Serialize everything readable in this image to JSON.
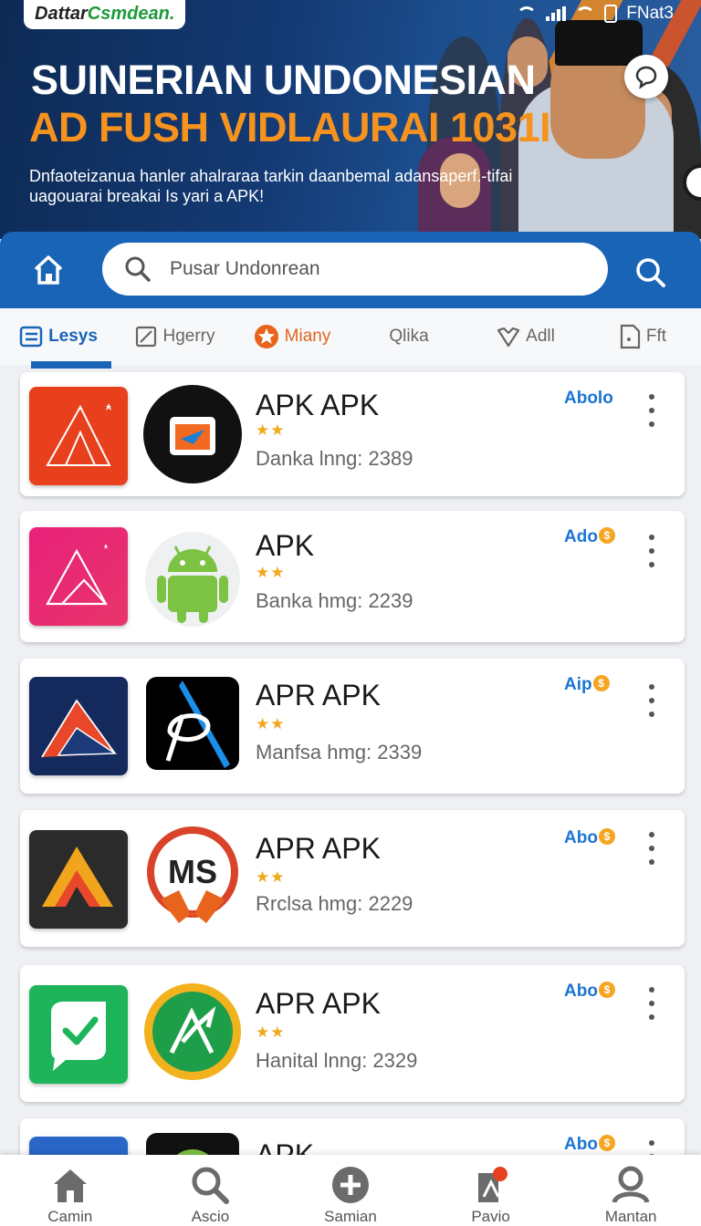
{
  "status_bar": {
    "label": "FNat3"
  },
  "banner": {
    "logo_part1": "Dattar",
    "logo_part2": "Csmdean.",
    "title_line1": "SUINERIAN UNDONESIAN",
    "title_line2": "AD FUSH VIDLAURAI 1031I",
    "subtitle": "Dnfaoteizanua hanler ahalraraa tarkin daanbemal adansaperf.-tifai uagouarai breakai Is yari a APK!"
  },
  "search": {
    "placeholder": "Pusar Undonrean"
  },
  "tabs": [
    {
      "label": "Lesys",
      "icon": "list-icon"
    },
    {
      "label": "Hgerry",
      "icon": "edit-icon"
    },
    {
      "label": "Miany",
      "icon": "star-badge-icon"
    },
    {
      "label": "Qlika",
      "icon": "search-q-icon"
    },
    {
      "label": "Adll",
      "icon": "heart-icon"
    },
    {
      "label": "Fft",
      "icon": "file-icon"
    }
  ],
  "apps": [
    {
      "name": "APK APK",
      "meta": "Danka lnng: 2389",
      "tag": "Abolo",
      "stars": "★★",
      "color1": "#e8401c",
      "color2": "#111111"
    },
    {
      "name": "APK",
      "meta": "Banka hmg: 2239",
      "tag": "Ado",
      "stars": "★★",
      "color1": "#e0207a",
      "color2": "#7cc243"
    },
    {
      "name": "APR APK",
      "meta": "Manfsa hmg: 2339",
      "tag": "Aip",
      "stars": "★★",
      "color1": "#14295c",
      "color2": "#000000"
    },
    {
      "name": "APR APK",
      "meta": "Rrclsa hmg: 2229",
      "tag": "Abo",
      "stars": "★★",
      "color1": "#2b2b2b",
      "color2": "#d9432a"
    },
    {
      "name": "APR APK",
      "meta": "Hanital lnng: 2329",
      "tag": "Abo",
      "stars": "★★",
      "color1": "#1eb55a",
      "color2": "#f2b21d"
    },
    {
      "name": "APK",
      "meta": "",
      "tag": "Abo",
      "stars": "",
      "color1": "#2a66c8",
      "color2": "#111111"
    }
  ],
  "bottom_nav": [
    {
      "label": "Camin",
      "icon": "home-icon"
    },
    {
      "label": "Ascio",
      "icon": "search-icon"
    },
    {
      "label": "Samian",
      "icon": "plus-circle-icon"
    },
    {
      "label": "Pavio",
      "icon": "notification-icon"
    },
    {
      "label": "Mantan",
      "icon": "profile-icon"
    }
  ]
}
